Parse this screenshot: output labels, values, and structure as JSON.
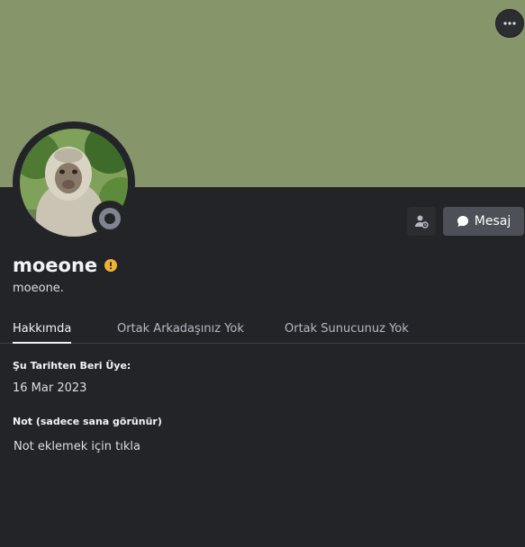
{
  "profile": {
    "display_name": "moeone",
    "username": "moeone.",
    "status": "offline",
    "banner_color": "#87956b",
    "badge_color": "#f0b232"
  },
  "actions": {
    "more_icon": "ellipsis-icon",
    "friend_icon": "add-friend-icon",
    "message_label": "Mesaj"
  },
  "tabs": [
    {
      "label": "Hakkımda",
      "active": true
    },
    {
      "label": "Ortak Arkadaşınız Yok",
      "active": false
    },
    {
      "label": "Ortak Sunucunuz Yok",
      "active": false
    }
  ],
  "about": {
    "member_since_title": "Şu Tarihten Beri Üye:",
    "member_since_value": "16 Mar 2023",
    "note_title": "Not (sadece sana görünür)",
    "note_placeholder": "Not eklemek için tıkla"
  }
}
